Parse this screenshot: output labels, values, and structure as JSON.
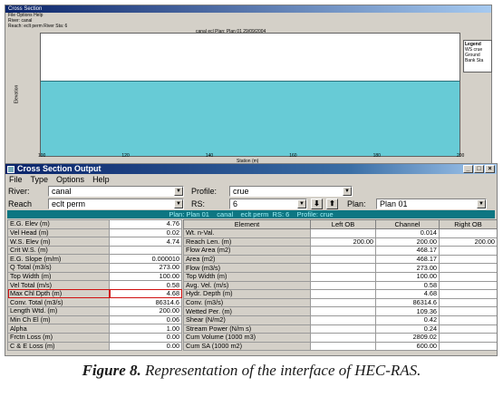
{
  "bg_window": {
    "title": "Cross Section",
    "menu_mini": "File   Options   Help",
    "river_mini": "River:  canal",
    "reach_mini": "Reach:  eclt perm        River Sta:  6",
    "plot_title": "canal ecl     Plan: Plan 01    29/09/2004",
    "legend_title": "Legend",
    "legend_items": [
      "WS crue",
      "Ground",
      "Bank Sta"
    ],
    "ylabel": "Elevation",
    "xlabel": "Station (m)",
    "xticks": [
      "100",
      "120",
      "140",
      "160",
      "180",
      "200"
    ]
  },
  "window": {
    "title": "Cross Section Output",
    "buttons": [
      "_",
      "□",
      "×"
    ]
  },
  "menu": [
    "File",
    "Type",
    "Options",
    "Help"
  ],
  "controls": {
    "river_label": "River:",
    "river_value": "canal",
    "profile_label": "Profile:",
    "profile_value": "crue",
    "reach_label": "Reach",
    "reach_value": "eclt perm",
    "rs_label": "RS:",
    "rs_value": "6",
    "plan_label": "Plan:",
    "plan_value": "Plan 01"
  },
  "plan_bar": "Plan: Plan 01    canal    eclt perm  RS: 6    Profile: crue",
  "left_table": [
    {
      "label": "E.G. Elev (m)",
      "value": "4.76"
    },
    {
      "label": "Vel Head (m)",
      "value": "0.02"
    },
    {
      "label": "W.S. Elev (m)",
      "value": "4.74"
    },
    {
      "label": "Crit W.S. (m)",
      "value": ""
    },
    {
      "label": "E.G. Slope (m/m)",
      "value": "0.000010"
    },
    {
      "label": "Q Total (m3/s)",
      "value": "273.00"
    },
    {
      "label": "Top Width (m)",
      "value": "100.00"
    },
    {
      "label": "Vel Total (m/s)",
      "value": "0.58"
    },
    {
      "label": "Max Chl Dpth (m)",
      "value": "4.68"
    },
    {
      "label": "Conv. Total (m3/s)",
      "value": "86314.6"
    },
    {
      "label": "Length Wtd. (m)",
      "value": "200.00"
    },
    {
      "label": "Min Ch El (m)",
      "value": "0.06"
    },
    {
      "label": "Alpha",
      "value": "1.00"
    },
    {
      "label": "Frctn Loss (m)",
      "value": "0.00"
    },
    {
      "label": "C & E Loss (m)",
      "value": "0.00"
    }
  ],
  "right_headers": [
    "Element",
    "Left OB",
    "Channel",
    "Right OB"
  ],
  "right_table": [
    [
      "Wt. n-Val.",
      "",
      "0.014",
      ""
    ],
    [
      "Reach Len. (m)",
      "200.00",
      "200.00",
      "200.00"
    ],
    [
      "Flow Area (m2)",
      "",
      "468.17",
      ""
    ],
    [
      "Area (m2)",
      "",
      "468.17",
      ""
    ],
    [
      "Flow (m3/s)",
      "",
      "273.00",
      ""
    ],
    [
      "Top Width (m)",
      "",
      "100.00",
      ""
    ],
    [
      "Avg. Vel. (m/s)",
      "",
      "0.58",
      ""
    ],
    [
      "Hydr. Depth (m)",
      "",
      "4.68",
      ""
    ],
    [
      "Conv. (m3/s)",
      "",
      "86314.6",
      ""
    ],
    [
      "Wetted Per. (m)",
      "",
      "109.36",
      ""
    ],
    [
      "Shear (N/m2)",
      "",
      "0.42",
      ""
    ],
    [
      "Stream Power (N/m s)",
      "",
      "0.24",
      ""
    ],
    [
      "Cum Volume (1000 m3)",
      "",
      "2809.02",
      ""
    ],
    [
      "Cum SA (1000 m2)",
      "",
      "600.00",
      ""
    ]
  ],
  "caption_bold": "Figure 8.",
  "caption_text": " Representation of the interface of HEC-RAS."
}
